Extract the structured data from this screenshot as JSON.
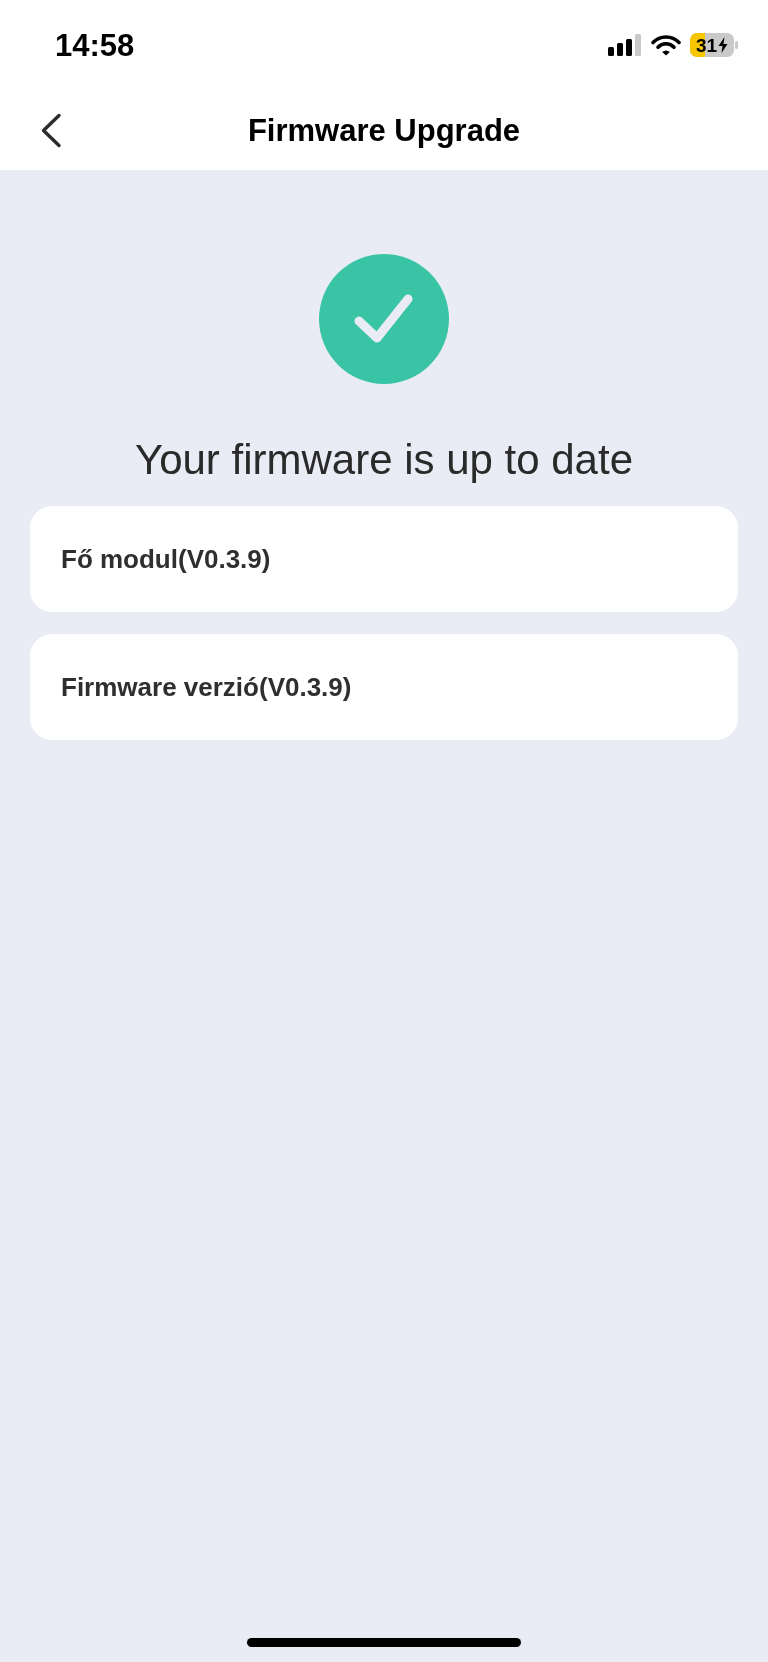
{
  "status_bar": {
    "time": "14:58",
    "battery": {
      "text": "31",
      "charging": true
    }
  },
  "nav_bar": {
    "title": "Firmware Upgrade"
  },
  "status": {
    "kind": "up_to_date",
    "message": "Your firmware is up to date"
  },
  "modules": [
    {
      "label": "Fő modul(V0.3.9)"
    },
    {
      "label": "Firmware verzió(V0.3.9)"
    }
  ]
}
